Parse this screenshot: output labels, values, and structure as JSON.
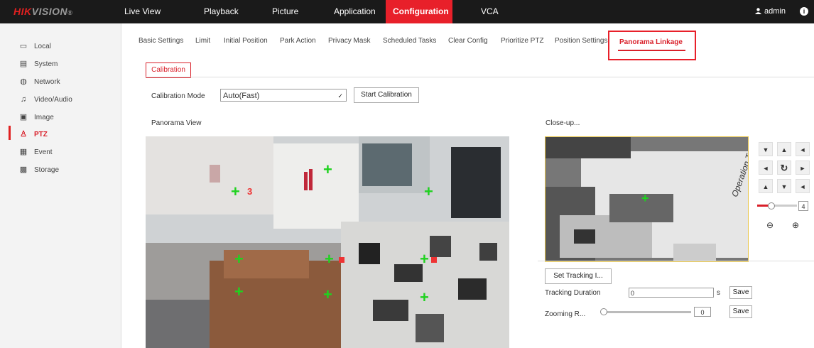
{
  "brand": {
    "part1": "HIK",
    "part2": "VISION",
    "reg": "®"
  },
  "nav": [
    "Live View",
    "Playback",
    "Picture",
    "Application",
    "Configuration",
    "VCA"
  ],
  "user": {
    "name": "admin",
    "info_glyph": "i"
  },
  "sidebar": [
    "Local",
    "System",
    "Network",
    "Video/Audio",
    "Image",
    "PTZ",
    "Event",
    "Storage"
  ],
  "tabs": [
    "Basic Settings",
    "Limit",
    "Initial Position",
    "Park Action",
    "Privacy Mask",
    "Scheduled Tasks",
    "Clear Config",
    "Prioritize PTZ",
    "Position Settings",
    "Panorama Linkage"
  ],
  "sub_tab": "Calibration",
  "calibration": {
    "mode_label": "Calibration Mode",
    "mode_value": "Auto(Fast)",
    "start_button": "Start Calibration"
  },
  "panorama": {
    "label": "Panorama View",
    "marker_label": "3"
  },
  "closeup": {
    "label": "Close-up...",
    "overlay_text": "Operation Tool"
  },
  "ptz": {
    "zoom_value": "4",
    "zoom_level": 0.35
  },
  "tracking": {
    "set_button": "Set Tracking I...",
    "duration_label": "Tracking Duration",
    "duration_value": "0",
    "duration_unit": "s",
    "save1": "Save",
    "zoom_label": "Zooming R...",
    "zoom_value": "0",
    "save2": "Save"
  },
  "colors": {
    "accent": "#e8202a",
    "topbar": "#1a1a1a",
    "sidebar": "#f3f3f3",
    "marker": "#1fd21f"
  }
}
